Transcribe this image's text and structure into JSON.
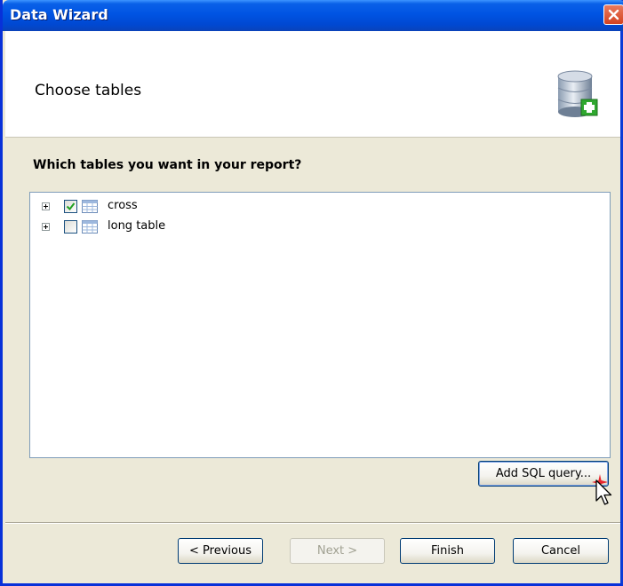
{
  "window": {
    "title": "Data Wizard",
    "close_icon": "close-icon"
  },
  "header": {
    "title": "Choose tables",
    "icon": "database-add-icon"
  },
  "prompt": "Which tables you want in your report?",
  "tables": [
    {
      "label": "cross",
      "checked": true
    },
    {
      "label": "long table",
      "checked": false
    }
  ],
  "buttons": {
    "add_sql": "Add SQL query...",
    "previous": "< Previous",
    "next": "Next >",
    "finish": "Finish",
    "cancel": "Cancel"
  },
  "colors": {
    "titlebar": "#0054e3",
    "dialog_bg": "#ece9d8",
    "close": "#d4421f",
    "check": "#21a121"
  }
}
